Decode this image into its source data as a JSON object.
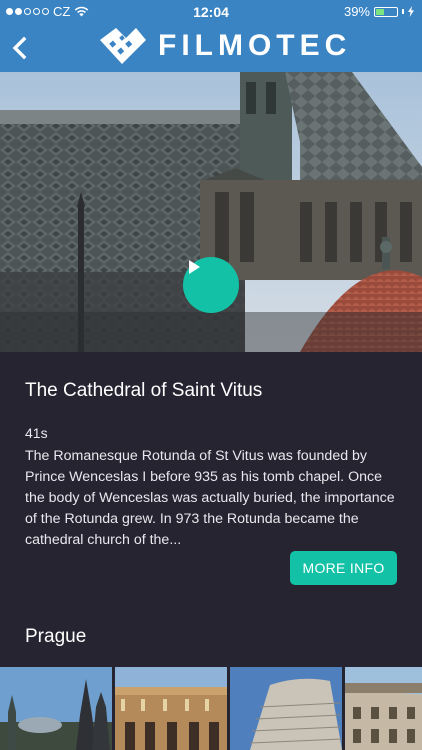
{
  "status_bar": {
    "carrier": "CZ",
    "time": "12:04",
    "battery_percent_label": "39%",
    "battery_level": 0.39,
    "signal_bars_filled": 2,
    "signal_bars_total": 5
  },
  "nav": {
    "brand_name": "FILMOTEC"
  },
  "video": {
    "title": "The Cathedral of Saint Vitus",
    "duration": "41s",
    "description": "The Romanesque Rotunda of St Vitus was founded by Prince Wenceslas I before 935 as his tomb chapel. Once the body of Wenceslas was actually buried, the importance of the Rotunda grew. In 973 the Rotunda became the cathedral church of the...",
    "more_info_label": "MORE INFO"
  },
  "section": {
    "title": "Prague",
    "thumbnails": [
      {
        "name": "prague-thumb-1"
      },
      {
        "name": "prague-thumb-2"
      },
      {
        "name": "prague-thumb-3"
      },
      {
        "name": "prague-thumb-4"
      }
    ]
  },
  "colors": {
    "nav_blue": "#3a84c4",
    "background": "#262431",
    "accent_teal": "#13c2a6"
  },
  "icons": {
    "back": "chevron-left-icon",
    "play": "play-icon",
    "wifi": "wifi-icon",
    "charging": "lightning-icon"
  }
}
